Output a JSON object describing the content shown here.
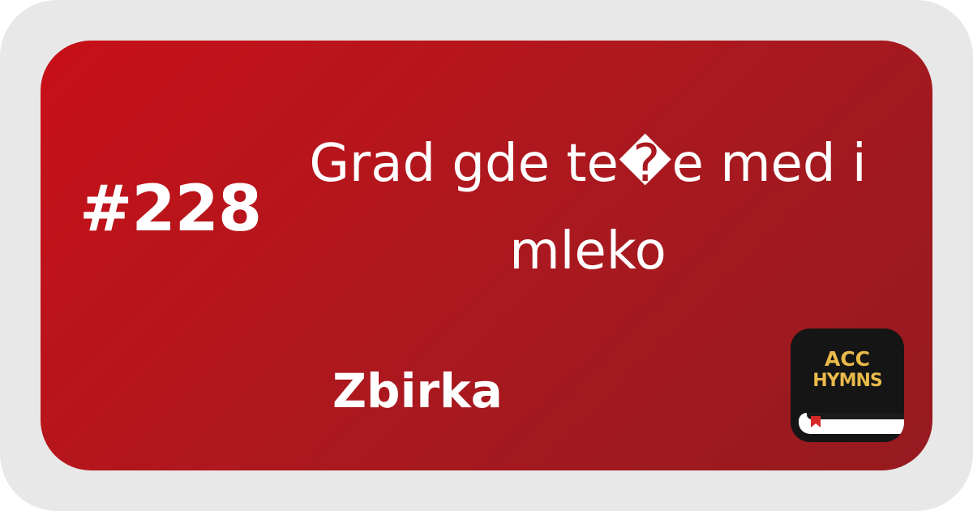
{
  "hymn": {
    "number": "#228",
    "title": "Grad gde te�e med i mleko",
    "collection": "Zbirka"
  },
  "app_icon": {
    "line1": "ACC",
    "line2": "HYMNS"
  },
  "colors": {
    "frame": "#e8e8e8",
    "card_start": "#c81018",
    "card_end": "#951a1f",
    "text": "#ffffff",
    "icon_bg": "#151515",
    "icon_text": "#e9b94a",
    "bookmark": "#d62828"
  }
}
